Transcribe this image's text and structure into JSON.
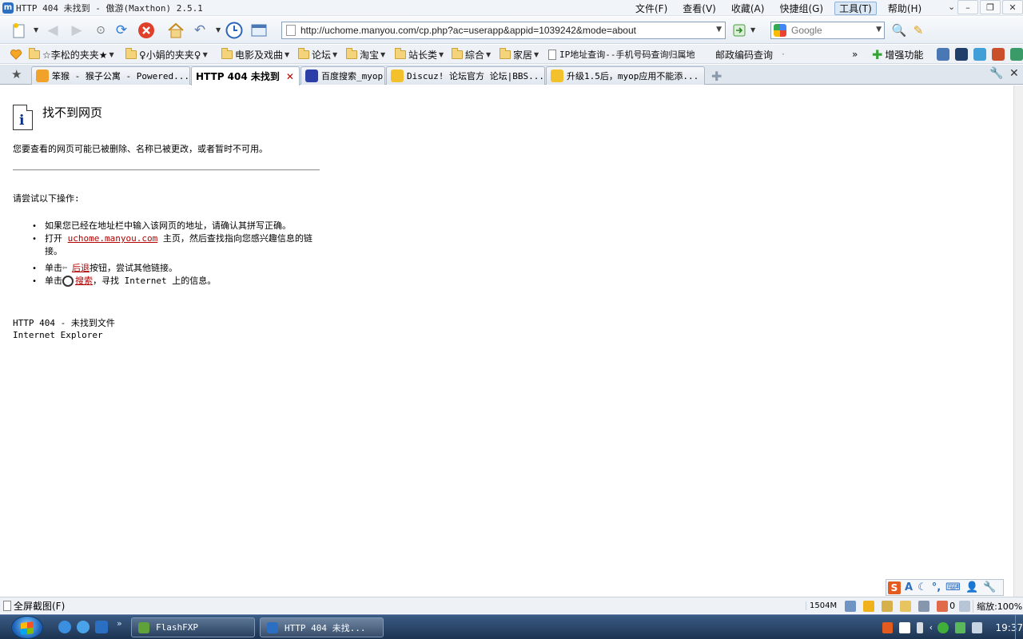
{
  "window": {
    "title": "HTTP 404 未找到 - 傲游(Maxthon) 2.5.1",
    "app_icon": "maxthon-icon"
  },
  "menu": [
    "文件(F)",
    "查看(V)",
    "收藏(A)",
    "快捷组(G)",
    "工具(T)",
    "帮助(H)"
  ],
  "menu_active_index": 4,
  "address": {
    "url": "http://uchome.manyou.com/cp.php?ac=userapp&appid=1039242&mode=about"
  },
  "search": {
    "placeholder": "Google"
  },
  "favorites": [
    {
      "label": "☆李松的夹夹★",
      "dropdown": true
    },
    {
      "label": "♀小娟的夹夹♀",
      "dropdown": true
    },
    {
      "label": "电影及戏曲",
      "dropdown": true
    },
    {
      "label": "论坛",
      "dropdown": true
    },
    {
      "label": "淘宝",
      "dropdown": true
    },
    {
      "label": "站长类",
      "dropdown": true
    },
    {
      "label": "綜合",
      "dropdown": true
    },
    {
      "label": "家居",
      "dropdown": true
    },
    {
      "label": "IP地址查询--手机号码查询归属地"
    },
    {
      "label": "邮政编码查询"
    }
  ],
  "favbar_right": {
    "enhance_label": "增强功能"
  },
  "tabs": [
    {
      "label": "笨猴 - 猴子公寓 - Powered...",
      "icon": "home-favicon",
      "active": false
    },
    {
      "label": "HTTP 404 未找到",
      "icon": "",
      "active": true
    },
    {
      "label": "百度搜索_myop",
      "icon": "baidu-favicon",
      "active": false
    },
    {
      "label": "Discuz! 论坛官方 论坛|BBS...",
      "icon": "discuz-favicon",
      "active": false
    },
    {
      "label": "升级1.5后，myop应用不能添...",
      "icon": "discuz-favicon",
      "active": false
    }
  ],
  "page": {
    "title": "找不到网页",
    "description": "您要查看的网页可能已被删除、名称已被更改，或者暂时不可用。",
    "try_label": "请尝试以下操作:",
    "tip1": "如果您已经在地址栏中输入该网页的地址，请确认其拼写正确。",
    "tip2_prefix": "打开",
    "tip2_link": "uchome.manyou.com",
    "tip2_suffix": "主页，然后查找指向您感兴趣信息的链接。",
    "tip3_prefix": "单击",
    "tip3_link": "后退",
    "tip3_suffix": "按钮，尝试其他链接。",
    "tip4_prefix": "单击",
    "tip4_link": "搜索",
    "tip4_suffix": "，寻找 Internet 上的信息。",
    "footer_code": "HTTP 404 - 未找到文件",
    "footer_app": "Internet Explorer"
  },
  "statusbar": {
    "left_text": "全屏截图(F)",
    "memory": "1504M",
    "counter": "0",
    "zoom": "缩放:100%"
  },
  "taskbar": {
    "tasks": [
      "FlashFXP",
      "HTTP 404 未找..."
    ],
    "clock": "19:37"
  },
  "colors": {
    "link": "#b20000",
    "taskbar": "#1d3452",
    "accent": "#2a6fc2"
  }
}
